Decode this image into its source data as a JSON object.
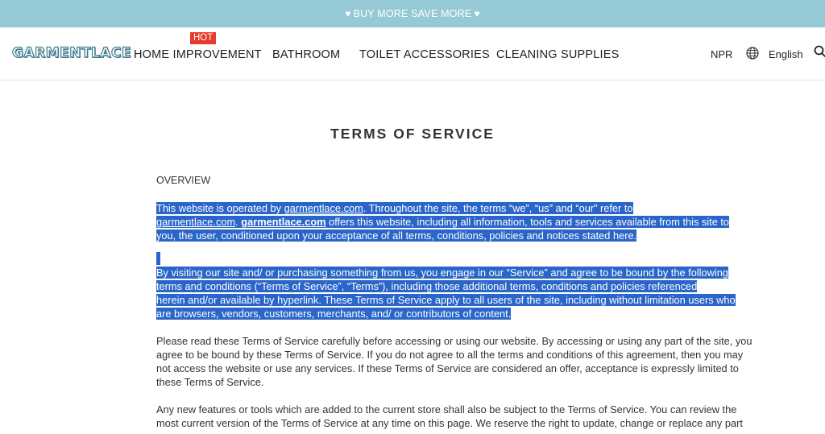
{
  "announcement": {
    "text": "BUY MORE SAVE MORE"
  },
  "header": {
    "logo": "GARMENTLACE",
    "nav": [
      {
        "label": "HOME IMPROVEMENT",
        "badge": "HOT"
      },
      {
        "label": "BATHROOM"
      },
      {
        "label": "TOILET ACCESSORIES"
      },
      {
        "label": "CLEANING SUPPLIES"
      }
    ],
    "currency": "NPR",
    "language": "English"
  },
  "page": {
    "title": "TERMS OF SERVICE",
    "section": "OVERVIEW",
    "p1": {
      "a": "This website is operated by ",
      "link1": "garmentlace.com",
      "b": ". Throughout the site, the terms “we”, “us” and “our” refer to",
      "link2": "garmentlace.com",
      "c": ". ",
      "link3": "garmentlace.com",
      "d": " offers this website, including all information, tools and services available from this site to",
      "e": "you, the user, conditioned upon your acceptance of all terms, conditions, policies and notices stated here."
    },
    "p2": [
      "By visiting our site and/ or purchasing something from us, you engage in our “Service” and agree to be bound by the following",
      "terms and conditions (“Terms of Service”, “Terms”), including those additional terms, conditions and policies referenced",
      "herein and/or available by hyperlink. These Terms of Service apply to all users of the site, including without limitation users who",
      "are browsers, vendors, customers, merchants, and/ or contributors of content."
    ],
    "p3": [
      "Please read these Terms of Service carefully before accessing or using our website. By accessing or using any part of the site, you",
      "agree to be bound by these Terms of Service. If you do not agree to all the terms and conditions of this agreement, then you may",
      "not access the website or use any services. If these Terms of Service are considered an offer, acceptance is expressly limited to",
      "these Terms of Service."
    ],
    "p4": [
      "Any new features or tools which are added to the current store shall also be subject to the Terms of Service. You can review the",
      "most current version of the Terms of Service at any time on this page. We reserve the right to update, change or replace any part"
    ]
  },
  "colors": {
    "announce_bg": "#96c9d6",
    "selection": "#2a66c9",
    "hot_badge": "#e53b2c"
  }
}
